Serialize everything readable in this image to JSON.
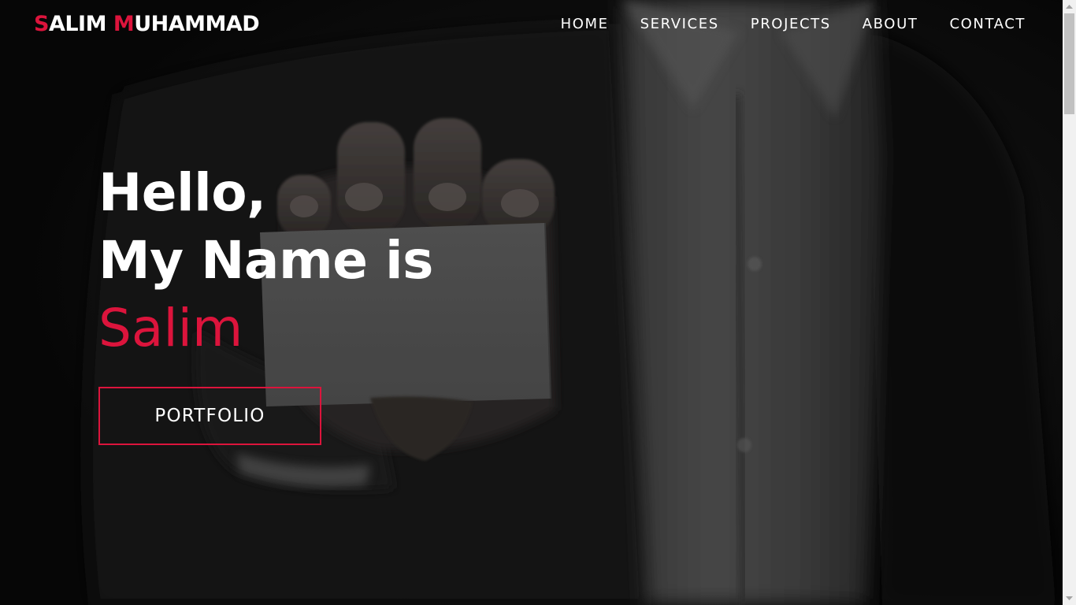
{
  "brand": {
    "first_initial": "S",
    "first_rest": "ALIM",
    "last_initial": "M",
    "last_rest": "UHAMMAD"
  },
  "nav": {
    "items": [
      {
        "label": "HOME"
      },
      {
        "label": "SERVICES"
      },
      {
        "label": "PROJECTS"
      },
      {
        "label": "ABOUT"
      },
      {
        "label": "CONTACT"
      }
    ]
  },
  "hero": {
    "line1": "Hello,",
    "line2": "My Name is",
    "name": "Salim",
    "cta_label": "PORTFOLIO"
  },
  "colors": {
    "accent": "#dc143c",
    "text": "#ffffff",
    "background": "#0b0b0b"
  }
}
